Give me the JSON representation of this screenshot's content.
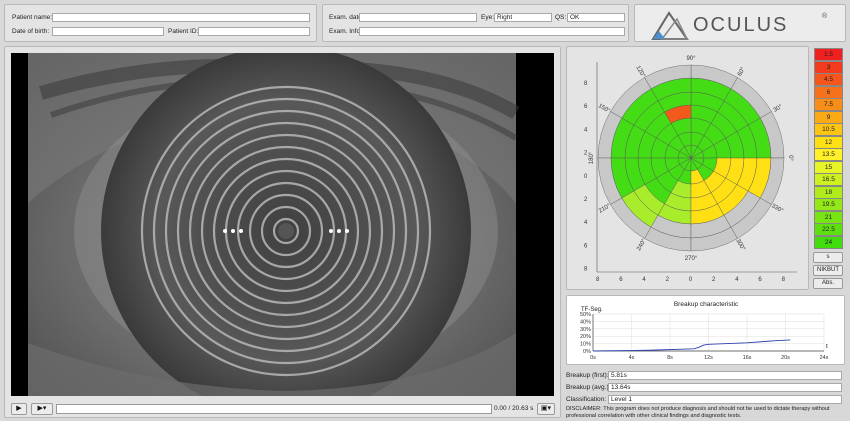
{
  "header": {
    "patient_name_label": "Patient name:",
    "patient_name_value": "",
    "dob_label": "Date of birth:",
    "dob_value": "",
    "patient_id_label": "Patient ID:",
    "patient_id_value": "",
    "exam_date_label": "Exam. date:",
    "exam_date_value": "",
    "eye_label": "Eye:",
    "eye_value": "Right",
    "qs_label": "QS:",
    "qs_value": "OK",
    "exam_info_label": "Exam. Info:",
    "exam_info_value": ""
  },
  "logo": {
    "text": "OCULUS",
    "mark": "®"
  },
  "player": {
    "play_icon": "play-icon",
    "speed_icon": "speed-dropdown-icon",
    "save_icon": "save-dropdown-icon",
    "time": "0.00 / 20.63 s",
    "progress": 0
  },
  "polar": {
    "angle_labels": [
      "90°",
      "60°",
      "30°",
      "0°",
      "330°",
      "300°",
      "270°",
      "240°",
      "210°",
      "180°",
      "150°",
      "120°"
    ],
    "y_ticks": [
      "8",
      "6",
      "4",
      "2",
      "0",
      "2",
      "4",
      "6",
      "8"
    ],
    "x_ticks": [
      "8",
      "6",
      "4",
      "2",
      "0",
      "2",
      "4",
      "6",
      "8"
    ]
  },
  "scale": {
    "values": [
      "1.5",
      "3",
      "4.5",
      "6",
      "7.5",
      "9",
      "10.5",
      "12",
      "13.5",
      "15",
      "16.5",
      "18",
      "19.5",
      "21",
      "22.5",
      "24"
    ],
    "colors": [
      "#f02020",
      "#f23a1e",
      "#f4561c",
      "#f6721a",
      "#f88e18",
      "#fbaa16",
      "#fdc414",
      "#ffe014",
      "#fff028",
      "#e6f428",
      "#ccf020",
      "#b0ec1c",
      "#94e818",
      "#78e414",
      "#5ee010",
      "#40dc0c"
    ]
  },
  "side_buttons": {
    "unit": "s",
    "mode": "NIKBUT",
    "abs": "Abs."
  },
  "breakup_chart": {
    "ylabel": "TF-Seg.",
    "title": "Breakup characteristic",
    "xlabel": "t"
  },
  "chart_data": {
    "type": "line",
    "title": "Breakup characteristic",
    "ylabel": "TF-Seg.",
    "xlabel": "t",
    "x_ticks": [
      "0s",
      "4s",
      "8s",
      "12s",
      "16s",
      "20s",
      "24s"
    ],
    "y_ticks": [
      "0%",
      "10%",
      "20%",
      "30%",
      "40%",
      "50%"
    ],
    "xlim": [
      0,
      24
    ],
    "ylim": [
      0,
      50
    ],
    "grid": true,
    "series": [
      {
        "color": "#3040b0",
        "x": [
          0,
          5.81,
          10.5,
          11.0,
          11.5,
          12.0,
          14.0,
          16.0,
          18.0,
          19.0,
          20.5
        ],
        "y": [
          0,
          1,
          3,
          5,
          8,
          9,
          10,
          11,
          13,
          14,
          15
        ]
      }
    ]
  },
  "info": {
    "breakup_first_label": "Breakup (first):",
    "breakup_first_value": "5.81s",
    "breakup_avg_label": "Breakup (avg.):",
    "breakup_avg_value": "13.64s",
    "classification_label": "Classification:",
    "classification_value": "Level 1",
    "disclaimer": "DISCLAIMER: This program does not produce diagnosis and should not be used to dictate therapy without professional correlation with other clinical findings and diagnostic tests."
  }
}
